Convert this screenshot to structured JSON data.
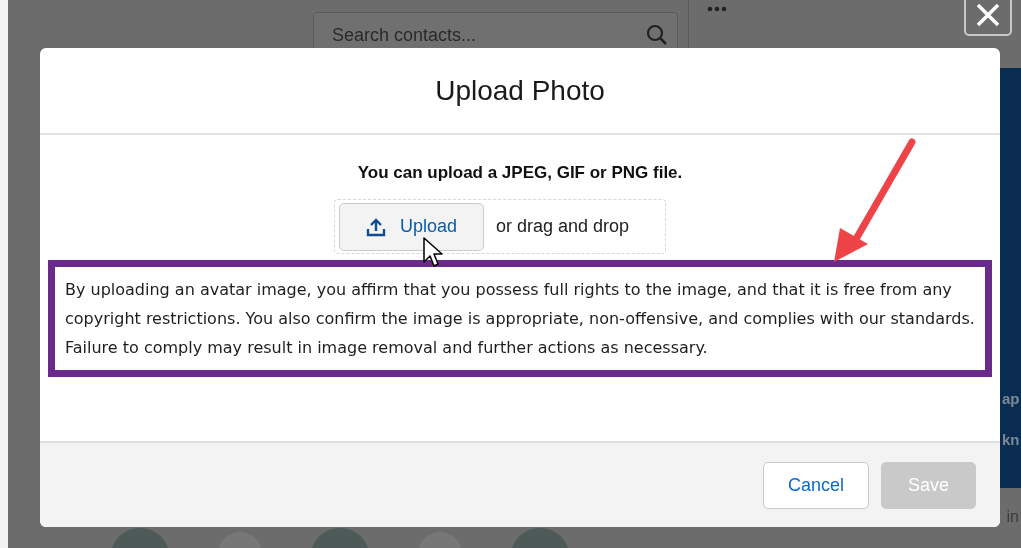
{
  "background": {
    "search": {
      "placeholder": "Search contacts..."
    },
    "panel_fragments": [
      "ap",
      "kn"
    ],
    "footer_fragment": "in"
  },
  "dialog": {
    "title": "Upload Photo",
    "hint": "You can upload a JPEG, GIF or PNG file.",
    "upload_button": "Upload",
    "drop_text": "or drag and drop",
    "notice": "By uploading an avatar image, you affirm that you possess full rights to the image, and that it is free from any copyright restrictions. You also confirm the image is appropriate, non-offensive, and complies with our standards. Failure to comply may result in image removal and further actions as necessary.",
    "buttons": [
      {
        "label": "Cancel",
        "disabled": false
      },
      {
        "label": "Save",
        "disabled": true
      }
    ]
  }
}
